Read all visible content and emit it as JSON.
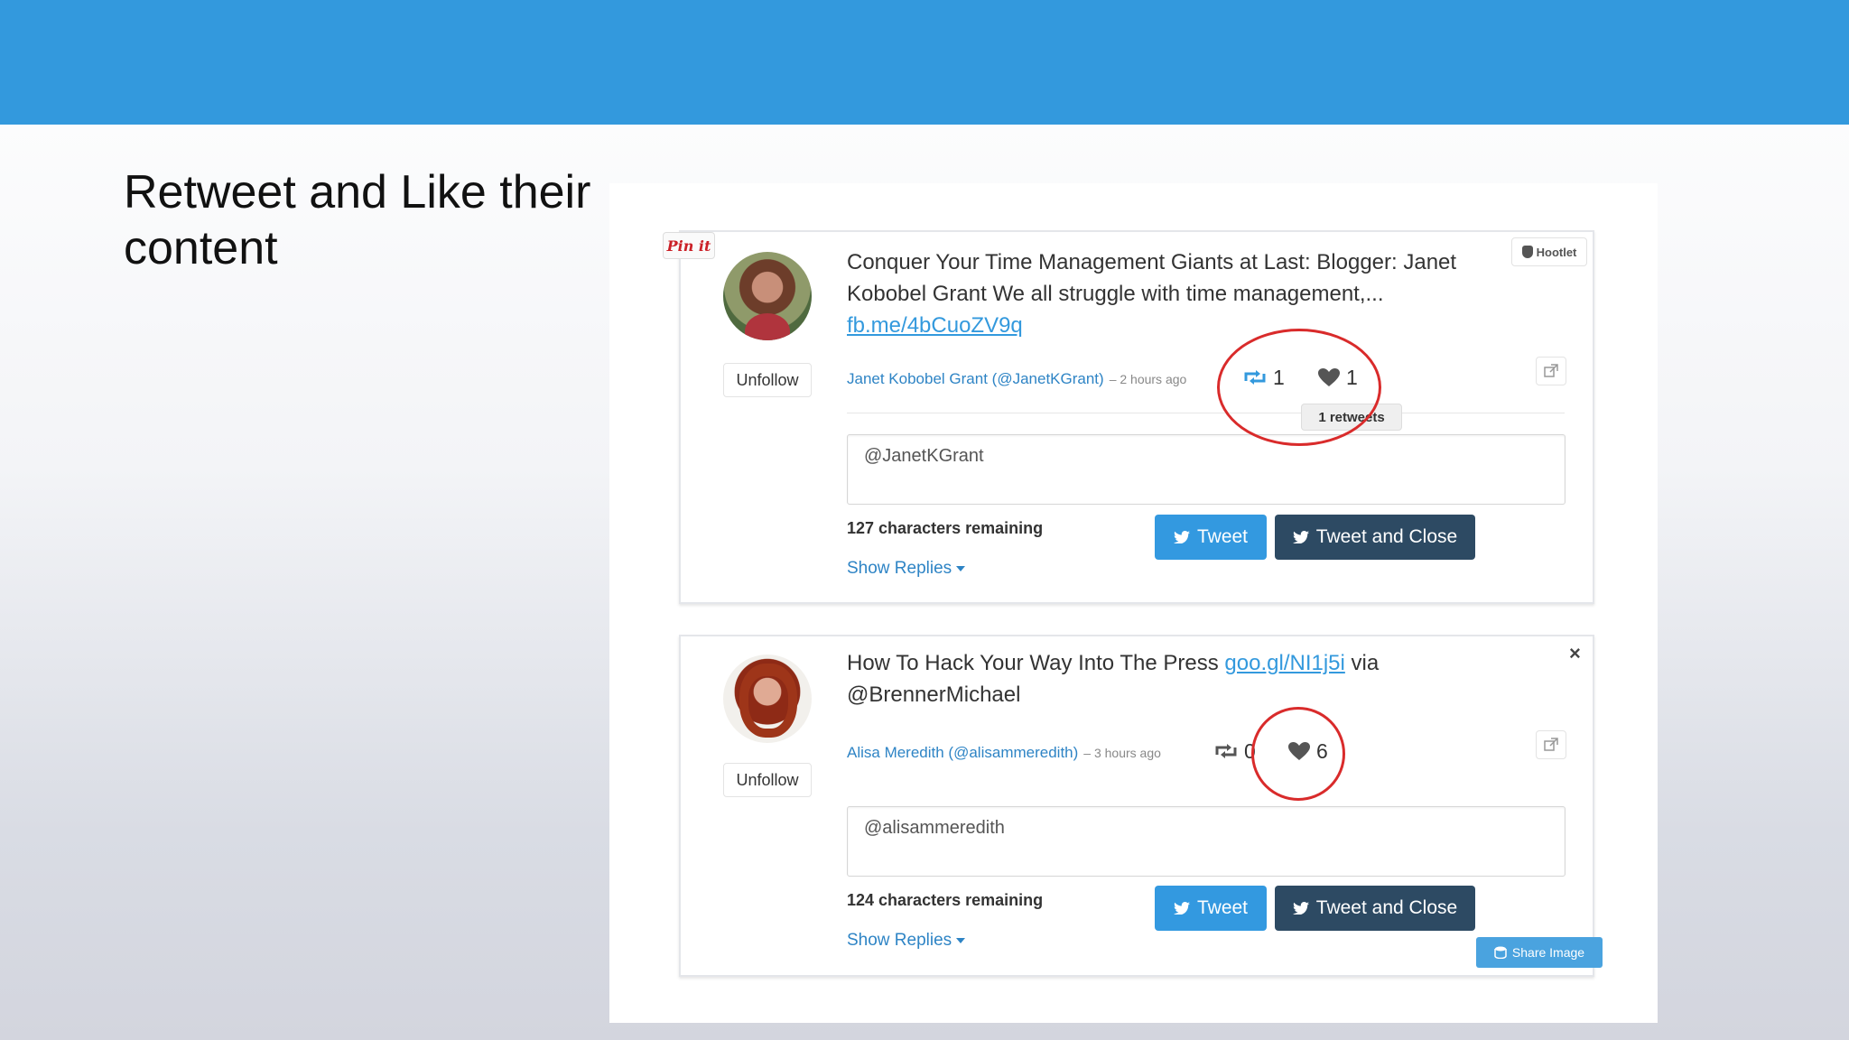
{
  "slide": {
    "title": "Retweet and Like their content"
  },
  "pin_it_label": "Pin it",
  "hootlet_label": "Hootlet",
  "tweets": [
    {
      "text": "Conquer Your Time Management Giants at Last: Blogger: Janet Kobobel Grant We all struggle with time management,...",
      "link": "fb.me/4bCuoZV9q",
      "author": "Janet Kobobel Grant (@JanetKGrant)",
      "time_ago": "– 2 hours ago",
      "retweets": "1",
      "likes": "1",
      "tooltip": "1 retweets",
      "unfollow_label": "Unfollow",
      "reply_value": "@JanetKGrant",
      "chars_remaining": "127 characters remaining",
      "show_replies": "Show Replies",
      "tweet_label": "Tweet",
      "tweet_close_label": "Tweet and Close"
    },
    {
      "text_before": "How To Hack Your Way Into The Press ",
      "link": "goo.gl/NI1j5i",
      "text_after": " via @BrennerMichael",
      "author": "Alisa Meredith (@alisammeredith)",
      "time_ago": "– 3 hours ago",
      "retweets": "0",
      "likes": "6",
      "unfollow_label": "Unfollow",
      "reply_value": "@alisammeredith",
      "chars_remaining": "124 characters remaining",
      "show_replies": "Show Replies",
      "tweet_label": "Tweet",
      "tweet_close_label": "Tweet and Close",
      "close_icon": "×"
    }
  ],
  "share_image_label": "Share Image",
  "colors": {
    "header": "#3399dd",
    "annotation": "#d92b2b",
    "tweet_button": "#3399e0",
    "tweet_close_button": "#2d4a63"
  }
}
